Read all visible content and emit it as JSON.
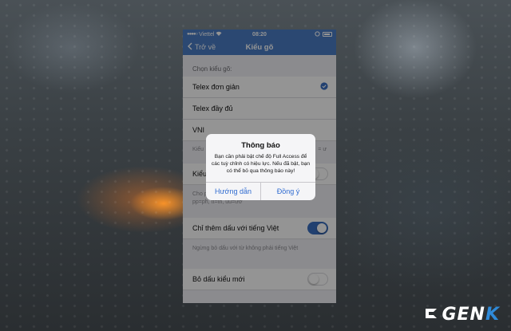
{
  "statusbar": {
    "carrier": "Viettel",
    "time": "08:20"
  },
  "navbar": {
    "back_label": "Trở về",
    "title": "Kiểu gõ"
  },
  "section": {
    "header": "Chọn kiểu gõ:"
  },
  "options": [
    {
      "label": "Telex đơn giản",
      "selected": true
    },
    {
      "label": "Telex đầy đủ",
      "selected": false
    },
    {
      "label": "VNI",
      "selected": false
    }
  ],
  "partial": {
    "note_left": "Kiểu",
    "note_right": "= ư",
    "row_label": "Kiểu"
  },
  "hint_text": "Cho phép gõ cc=ch, gg=gi, kk=kh, nn=ng, qq=qu, pp=ph, tt=th, uu=ươ",
  "toggles": [
    {
      "label": "Chỉ thêm dấu với tiếng Việt",
      "on": true,
      "note": "Ngừng bỏ dấu với từ không phải tiếng Việt"
    },
    {
      "label": "Bỏ dấu kiểu mới",
      "on": false
    }
  ],
  "alert": {
    "title": "Thông báo",
    "message": "Bạn cần phải bật chế độ Full Access để các tuỳ chỉnh có hiệu lực. Nếu đã bật, bạn có thể bỏ qua thông báo này!",
    "button_left": "Hướng dẫn",
    "button_right": "Đồng ý"
  },
  "watermark": {
    "text_main": "GEN",
    "text_accent": "K"
  },
  "colors": {
    "nav": "#4a7dc4",
    "accent": "#2f6bd0",
    "toggle_on": "#3a6fc1"
  }
}
